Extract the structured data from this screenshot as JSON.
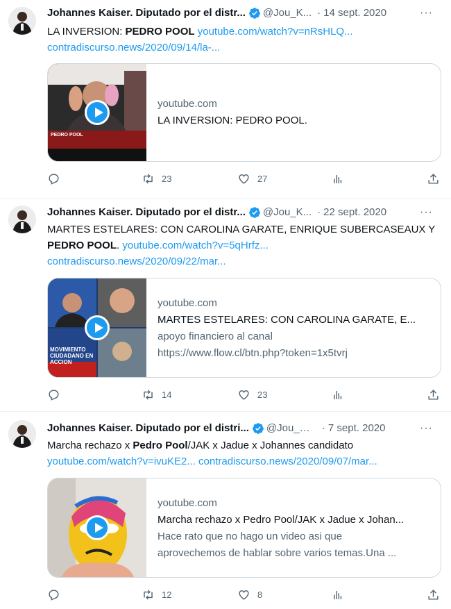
{
  "colors": {
    "link": "#1d9bf0",
    "muted": "#536471",
    "text": "#0f1419",
    "verified": "#1d9bf0"
  },
  "tweets": [
    {
      "author_name": "Johannes Kaiser. Diputado por el distr...",
      "handle": "@Jou_K...",
      "separator": "·",
      "date": "14 sept. 2020",
      "more": "···",
      "text_prefix": "LA INVERSION: ",
      "text_bold": "PEDRO POOL",
      "text_suffix": " ",
      "link1": "youtube.com/watch?v=nRsHLQ...",
      "link2": "contradiscurso.news/2020/09/14/la-...",
      "card": {
        "domain": "youtube.com",
        "title": "LA INVERSION: PEDRO POOL.",
        "desc1": "",
        "desc2": "",
        "thumb_caption": "PEDRO POOL"
      },
      "replies": "",
      "retweets": "23",
      "likes": "27"
    },
    {
      "author_name": "Johannes Kaiser. Diputado por el distr...",
      "handle": "@Jou_K...",
      "separator": "·",
      "date": "22 sept. 2020",
      "more": "···",
      "text_prefix": "MARTES ESTELARES: CON CAROLINA GARATE, ENRIQUE SUBERCASEAUX Y ",
      "text_bold": "PEDRO POOL",
      "text_suffix": ". ",
      "link1": "youtube.com/watch?v=5qHrfz...",
      "link2": "contradiscurso.news/2020/09/22/mar...",
      "card": {
        "domain": "youtube.com",
        "title": "MARTES ESTELARES: CON CAROLINA GARATE, E...",
        "desc1": "apoyo financiero al canal",
        "desc2": "https://www.flow.cl/btn.php?token=1x5tvrj",
        "thumb_caption": "MOVIMIENTO CIUDADANO EN ACCION"
      },
      "replies": "",
      "retweets": "14",
      "likes": "23"
    },
    {
      "author_name": "Johannes Kaiser. Diputado por el distri...",
      "handle": "@Jou_Ka...",
      "separator": "·",
      "date": "7 sept. 2020",
      "more": "···",
      "text_prefix": "Marcha rechazo x ",
      "text_bold": "Pedro Pool",
      "text_suffix": "/JAK x Jadue x Johannes candidato",
      "link1": "youtube.com/watch?v=ivuKE2...",
      "link2": "contradiscurso.news/2020/09/07/mar...",
      "card": {
        "domain": "youtube.com",
        "title": "Marcha rechazo x Pedro Pool/JAK x Jadue x Johan...",
        "desc1": "Hace rato que no hago un video asi que",
        "desc2": "aprovechemos de hablar sobre varios temas.Una ...",
        "thumb_caption": ""
      },
      "replies": "",
      "retweets": "12",
      "likes": "8"
    }
  ],
  "icons": [
    "reply-icon",
    "retweet-icon",
    "like-icon",
    "views-icon",
    "share-icon",
    "verified-icon",
    "play-icon"
  ]
}
